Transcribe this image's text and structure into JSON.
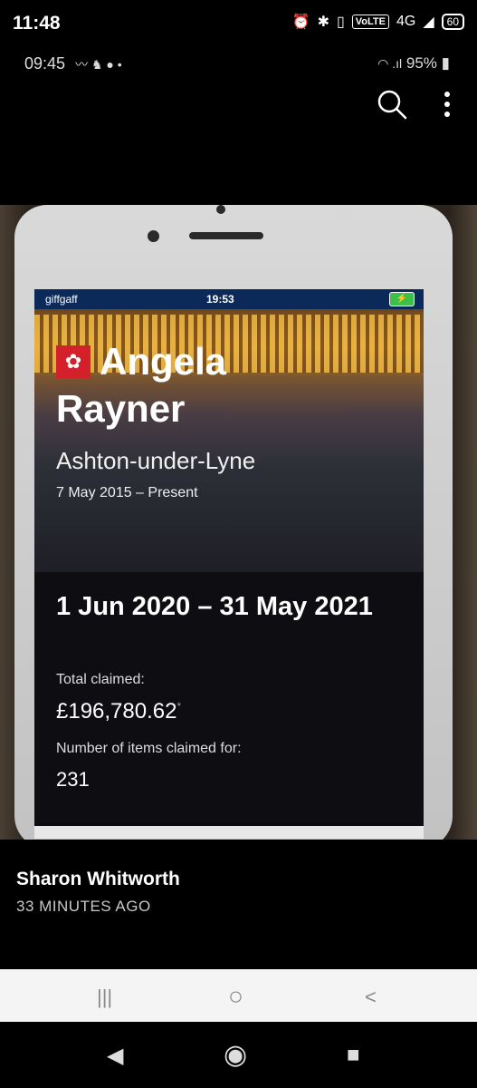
{
  "status_bar": {
    "time": "11:48",
    "network": "VoLTE",
    "signal": "4G",
    "battery": "60"
  },
  "viewer_status": {
    "time": "09:45",
    "battery": "95%"
  },
  "toolbar": {
    "search_icon": "search-icon",
    "more_icon": "more-vert-icon"
  },
  "photo": {
    "phone_status": {
      "carrier": "giffgaff",
      "time": "19:53"
    },
    "profile": {
      "first_name": "Angela",
      "last_name": "Rayner",
      "constituency": "Ashton-under-Lyne",
      "term": "7 May 2015 – Present"
    },
    "claims": {
      "period": "1 Jun 2020 – 31 May 2021",
      "total_label": "Total claimed:",
      "total_value": "£196,780.62",
      "total_marker": "*",
      "items_label": "Number of items claimed for:",
      "items_value": "231"
    }
  },
  "post": {
    "author": "Sharon Whitworth",
    "time_ago": "33 MINUTES AGO"
  },
  "nav_bar": {
    "recents": "|||",
    "home": "○",
    "back": "<"
  },
  "system_nav": {
    "back": "◀",
    "home": "◉",
    "recents": "■"
  }
}
